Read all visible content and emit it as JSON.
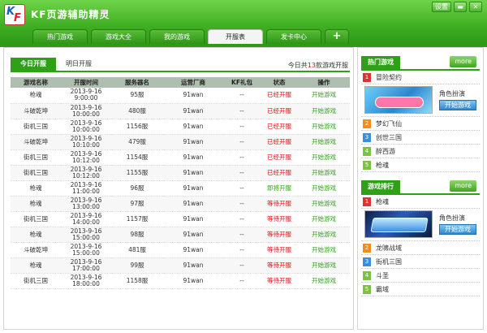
{
  "app": {
    "title": "KF页游辅助精灵",
    "logo_letters": "KF"
  },
  "window": {
    "settings": "设置",
    "minimize_icon": "minimize-icon",
    "close_icon": "close-icon"
  },
  "tabs": [
    {
      "label": "热门游戏",
      "active": false
    },
    {
      "label": "游戏大全",
      "active": false
    },
    {
      "label": "我的游戏",
      "active": false
    },
    {
      "label": "开服表",
      "active": true
    },
    {
      "label": "发卡中心",
      "active": false
    },
    {
      "label": "+",
      "active": false
    }
  ],
  "schedule": {
    "subtabs": [
      "今日开服",
      "明日开服"
    ],
    "summary_prefix": "今日共",
    "summary_count": "13",
    "summary_suffix": "款游戏开服",
    "columns": [
      "游戏名称",
      "开服时间",
      "服务器名",
      "运营厂商",
      "KF礼包",
      "状态",
      "操作"
    ],
    "rows": [
      {
        "game": "枪魂",
        "date": "2013-9-16",
        "time": "9:00:00",
        "server": "95服",
        "vendor": "91wan",
        "gift": "--",
        "status": "已经开服",
        "action": "开始游戏"
      },
      {
        "game": "斗破乾坤",
        "date": "2013-9-16",
        "time": "10:00:00",
        "server": "480服",
        "vendor": "91wan",
        "gift": "--",
        "status": "已经开服",
        "action": "开始游戏"
      },
      {
        "game": "街机三国",
        "date": "2013-9-16",
        "time": "10:00:00",
        "server": "1156服",
        "vendor": "91wan",
        "gift": "--",
        "status": "已经开服",
        "action": "开始游戏"
      },
      {
        "game": "斗破乾坤",
        "date": "2013-9-16",
        "time": "10:10:00",
        "server": "479服",
        "vendor": "91wan",
        "gift": "--",
        "status": "已经开服",
        "action": "开始游戏"
      },
      {
        "game": "街机三国",
        "date": "2013-9-16",
        "time": "10:12:00",
        "server": "1154服",
        "vendor": "91wan",
        "gift": "--",
        "status": "已经开服",
        "action": "开始游戏"
      },
      {
        "game": "街机三国",
        "date": "2013-9-16",
        "time": "10:12:00",
        "server": "1155服",
        "vendor": "91wan",
        "gift": "--",
        "status": "已经开服",
        "action": "开始游戏"
      },
      {
        "game": "枪魂",
        "date": "2013-9-16",
        "time": "11:00:00",
        "server": "96服",
        "vendor": "91wan",
        "gift": "--",
        "status": "即将开服",
        "action": "开始游戏"
      },
      {
        "game": "枪魂",
        "date": "2013-9-16",
        "time": "13:00:00",
        "server": "97服",
        "vendor": "91wan",
        "gift": "--",
        "status": "等待开服",
        "action": "开始游戏"
      },
      {
        "game": "街机三国",
        "date": "2013-9-16",
        "time": "14:00:00",
        "server": "1157服",
        "vendor": "91wan",
        "gift": "--",
        "status": "等待开服",
        "action": "开始游戏"
      },
      {
        "game": "枪魂",
        "date": "2013-9-16",
        "time": "15:00:00",
        "server": "98服",
        "vendor": "91wan",
        "gift": "--",
        "status": "等待开服",
        "action": "开始游戏"
      },
      {
        "game": "斗破乾坤",
        "date": "2013-9-16",
        "time": "15:00:00",
        "server": "481服",
        "vendor": "91wan",
        "gift": "--",
        "status": "等待开服",
        "action": "开始游戏"
      },
      {
        "game": "枪魂",
        "date": "2013-9-16",
        "time": "17:00:00",
        "server": "99服",
        "vendor": "91wan",
        "gift": "--",
        "status": "等待开服",
        "action": "开始游戏"
      },
      {
        "game": "街机三国",
        "date": "2013-9-16",
        "time": "18:00:00",
        "server": "1158服",
        "vendor": "91wan",
        "gift": "--",
        "status": "等待开服",
        "action": "开始游戏"
      }
    ]
  },
  "hot_games": {
    "title": "热门游戏",
    "more": "more",
    "featured": {
      "name": "冒险契约",
      "genre": "角色扮演",
      "play": "开始游戏"
    },
    "items": [
      "梦幻飞仙",
      "创世三国",
      "醉西游",
      "枪魂"
    ]
  },
  "ranking": {
    "title": "游戏排行",
    "more": "more",
    "featured": {
      "name": "枪魂",
      "genre": "角色扮演",
      "play": "开始游戏"
    },
    "items": [
      "龙啸战域",
      "街机三国",
      "斗圣",
      "霸域"
    ]
  },
  "colors": {
    "accent": "#2fa116",
    "open": "#dd1111",
    "soon": "#2fa116",
    "wait": "#dd1111"
  }
}
